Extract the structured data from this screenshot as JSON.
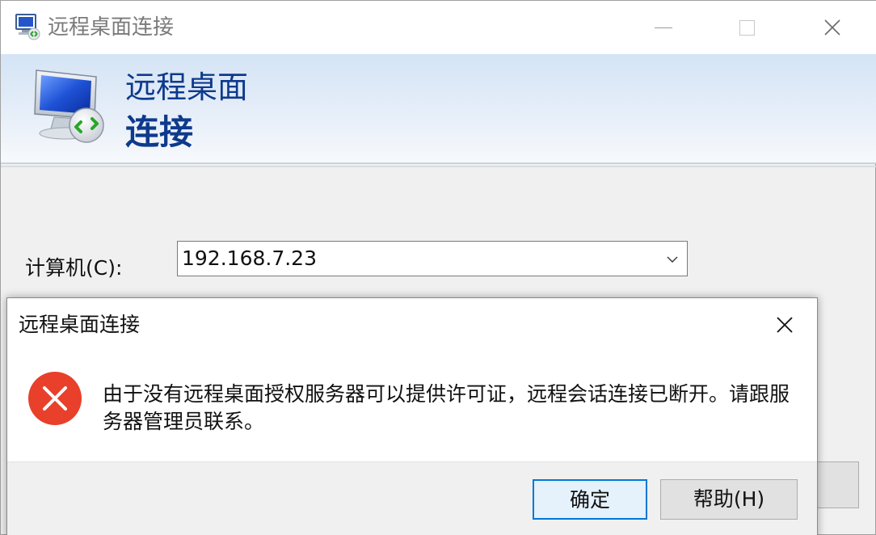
{
  "window": {
    "title": "远程桌面连接",
    "buttons": {
      "minimize": "minimize",
      "maximize": "maximize",
      "close": "close"
    }
  },
  "banner": {
    "line1": "远程桌面",
    "line2": "连接"
  },
  "form": {
    "computer_label": "计算机(C):",
    "computer_value": "192.168.7.23"
  },
  "dialog": {
    "title": "远程桌面连接",
    "message": "由于没有远程桌面授权服务器可以提供许可证，远程会话连接已断开。请跟服务器管理员联系。",
    "ok_label": "确定",
    "help_label": "帮助(H)",
    "icon": "error-icon"
  },
  "colors": {
    "brand_blue": "#0e3a8c",
    "error_red": "#e8402a",
    "focus_blue": "#0078d7"
  }
}
